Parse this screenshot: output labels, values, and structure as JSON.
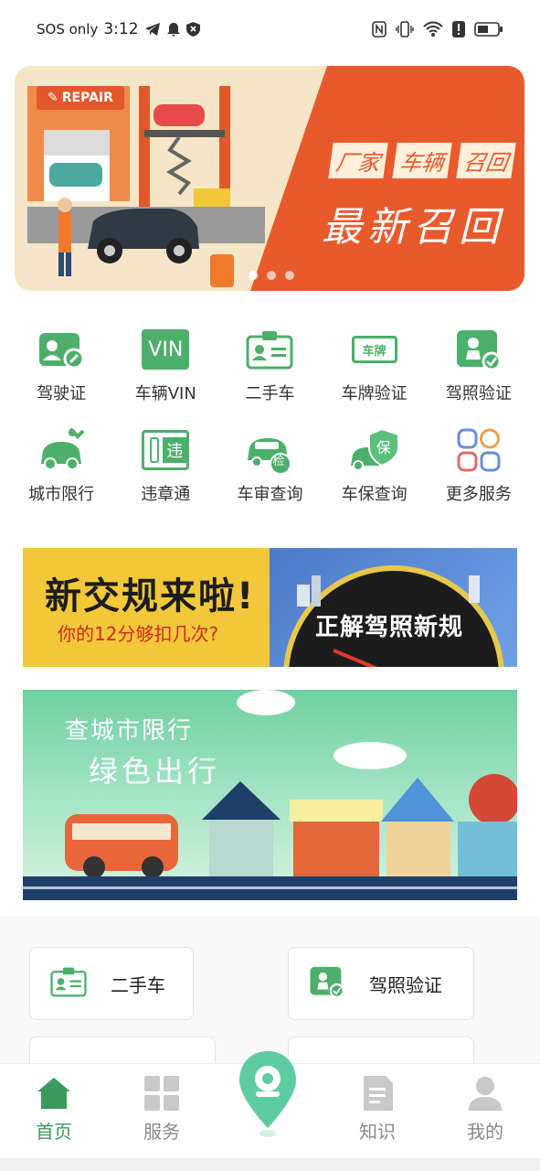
{
  "status_bar": {
    "carrier": "SOS only",
    "time": "3:12"
  },
  "banner": {
    "badge_text": "REPAIR",
    "tags": [
      "厂家",
      "车辆",
      "召回"
    ],
    "title": "最新召回"
  },
  "services": [
    {
      "label": "驾驶证",
      "icon": "driver-license-icon"
    },
    {
      "label": "车辆VIN",
      "icon": "vin-icon",
      "icon_text": "VIN"
    },
    {
      "label": "二手车",
      "icon": "used-car-card-icon"
    },
    {
      "label": "车牌验证",
      "icon": "license-plate-icon",
      "icon_text": "车牌"
    },
    {
      "label": "驾照验证",
      "icon": "license-verify-icon"
    },
    {
      "label": "城市限行",
      "icon": "city-restriction-icon"
    },
    {
      "label": "违章通",
      "icon": "violation-icon",
      "icon_text": "违"
    },
    {
      "label": "车审查询",
      "icon": "car-inspection-icon",
      "icon_text": "检"
    },
    {
      "label": "车保查询",
      "icon": "car-insurance-icon",
      "icon_text": "保"
    },
    {
      "label": "更多服务",
      "icon": "more-services-icon"
    }
  ],
  "ad_traffic_rules": {
    "title": "新交规来啦!",
    "subtitle": "你的12分够扣几次?",
    "right_text": "正解驾照新规"
  },
  "ad_city": {
    "line1": "查城市限行",
    "line2": "绿色出行"
  },
  "quick_links": [
    {
      "label": "二手车",
      "icon": "used-car-card-icon"
    },
    {
      "label": "驾照验证",
      "icon": "license-verify-icon"
    }
  ],
  "tabs": [
    {
      "label": "首页",
      "icon": "home-icon",
      "active": true
    },
    {
      "label": "服务",
      "icon": "grid-icon",
      "active": false
    },
    {
      "label": "",
      "icon": "location-pin-icon",
      "active": false
    },
    {
      "label": "知识",
      "icon": "document-icon",
      "active": false
    },
    {
      "label": "我的",
      "icon": "user-icon",
      "active": false
    }
  ],
  "colors": {
    "brand_green": "#3c9a5f",
    "icon_green": "#4caf6a",
    "banner_orange": "#e85a2c",
    "ad_yellow": "#f2c83a"
  }
}
